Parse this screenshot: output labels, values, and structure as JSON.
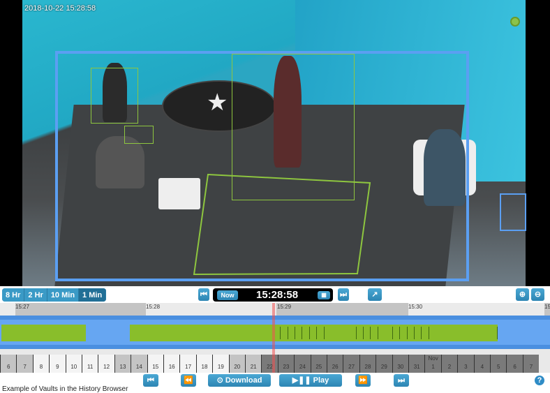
{
  "video": {
    "timestamp": "2018-10-22 15:28:58",
    "camera_status_icon": "camera-status-icon",
    "colors": {
      "region_box": "#5b9ff2",
      "motion_box": "#8ec63f"
    }
  },
  "toolbar": {
    "range_buttons": [
      {
        "label": "8 Hr",
        "active": false
      },
      {
        "label": "2 Hr",
        "active": false
      },
      {
        "label": "10 Min",
        "active": false
      },
      {
        "label": "1 Min",
        "active": true
      }
    ],
    "skip_back_icon": "skip-to-start-icon",
    "now_label": "Now",
    "current_time": "15:28:58",
    "calendar_icon": "calendar-icon",
    "skip_forward_icon": "skip-to-end-icon",
    "share_icon": "share-icon",
    "zoom_in_icon": "zoom-in-icon",
    "zoom_out_icon": "zoom-out-icon"
  },
  "timeline": {
    "ruler_labels": [
      "15:27",
      "15:28",
      "15:29",
      "15:30",
      "15"
    ],
    "colors": {
      "recording": "#89be2b",
      "band": "#4a8fe0",
      "band_inner": "#66a6f2",
      "cursor": "#f05050"
    }
  },
  "days": {
    "month_label": "Nov",
    "items": [
      "6",
      "7",
      "8",
      "9",
      "10",
      "11",
      "12",
      "13",
      "14",
      "15",
      "16",
      "17",
      "18",
      "19",
      "20",
      "21",
      "22",
      "23",
      "24",
      "25",
      "26",
      "27",
      "28",
      "29",
      "30",
      "31",
      "1",
      "2",
      "3",
      "4",
      "5",
      "6",
      "7"
    ]
  },
  "controls": {
    "first_icon": "first-icon",
    "rewind_icon": "rewind-icon",
    "download_label": "Download",
    "play_label": "Play",
    "fast_forward_icon": "fast-forward-icon",
    "last_icon": "last-icon",
    "help_label": "?"
  },
  "caption": "Example of Vaults in the History Browser"
}
